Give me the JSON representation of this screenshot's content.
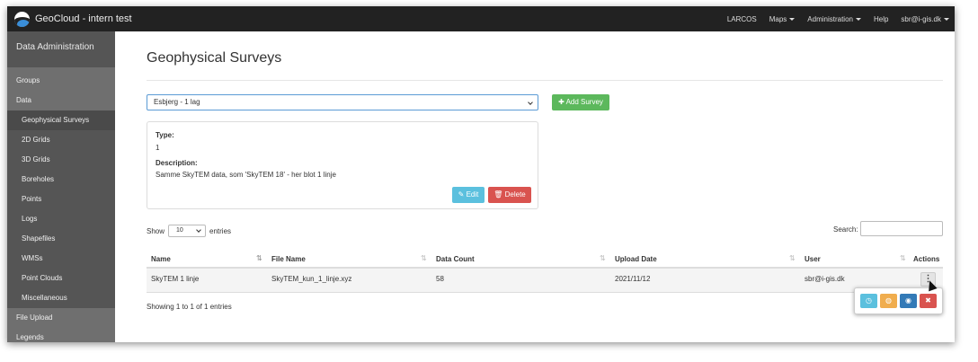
{
  "navbar": {
    "title": "GeoCloud - intern test",
    "items": [
      {
        "label": "LARCOS",
        "dropdown": false
      },
      {
        "label": "Maps",
        "dropdown": true
      },
      {
        "label": "Administration",
        "dropdown": true
      },
      {
        "label": "Help",
        "dropdown": false
      },
      {
        "label": "sbr@i-gis.dk",
        "dropdown": true
      }
    ]
  },
  "sidebar": {
    "heading": "Data Administration",
    "items": [
      {
        "label": "Groups"
      },
      {
        "label": "Data"
      },
      {
        "label": "Geophysical Surveys"
      },
      {
        "label": "2D Grids"
      },
      {
        "label": "3D Grids"
      },
      {
        "label": "Boreholes"
      },
      {
        "label": "Points"
      },
      {
        "label": "Logs"
      },
      {
        "label": "Shapefiles"
      },
      {
        "label": "WMSs"
      },
      {
        "label": "Point Clouds"
      },
      {
        "label": "Miscellaneous"
      },
      {
        "label": "File Upload"
      },
      {
        "label": "Legends"
      }
    ]
  },
  "main": {
    "title": "Geophysical Surveys",
    "survey_select": {
      "value": "Esbjerg - 1 lag"
    },
    "add_button": "Add Survey",
    "details": {
      "type_label": "Type:",
      "type_value": "1",
      "description_label": "Description:",
      "description_value": "Samme SkyTEM data, som 'SkyTEM 18' - her blot 1 linje",
      "edit_button": "Edit",
      "delete_button": "Delete"
    },
    "table": {
      "length_prefix": "Show",
      "length_value": "10",
      "length_suffix": "entries",
      "search_label": "Search:",
      "columns": [
        "Name",
        "File Name",
        "Data Count",
        "Upload Date",
        "User",
        "Actions"
      ],
      "rows": [
        {
          "name": "SkyTEM 1 linje",
          "file_name": "SkyTEM_kun_1_linje.xyz",
          "data_count": "58",
          "upload_date": "2021/11/12",
          "user": "sbr@i-gis.dk"
        }
      ],
      "info": "Showing 1 to 1 of 1 entries"
    }
  },
  "colors": {
    "navbar": "#222222",
    "sidebar": "#6f6f6f",
    "success": "#5cb85c",
    "info": "#5bc0de",
    "danger": "#d9534f",
    "warning": "#f0ad4e",
    "primary": "#337ab7"
  },
  "icons": {
    "add": "plus-icon",
    "edit": "edit-icon",
    "delete": "trash-icon",
    "actions": "kebab-vertical-icon",
    "popup": [
      "clock-icon",
      "globe-icon",
      "eye-icon",
      "trash-icon"
    ]
  }
}
